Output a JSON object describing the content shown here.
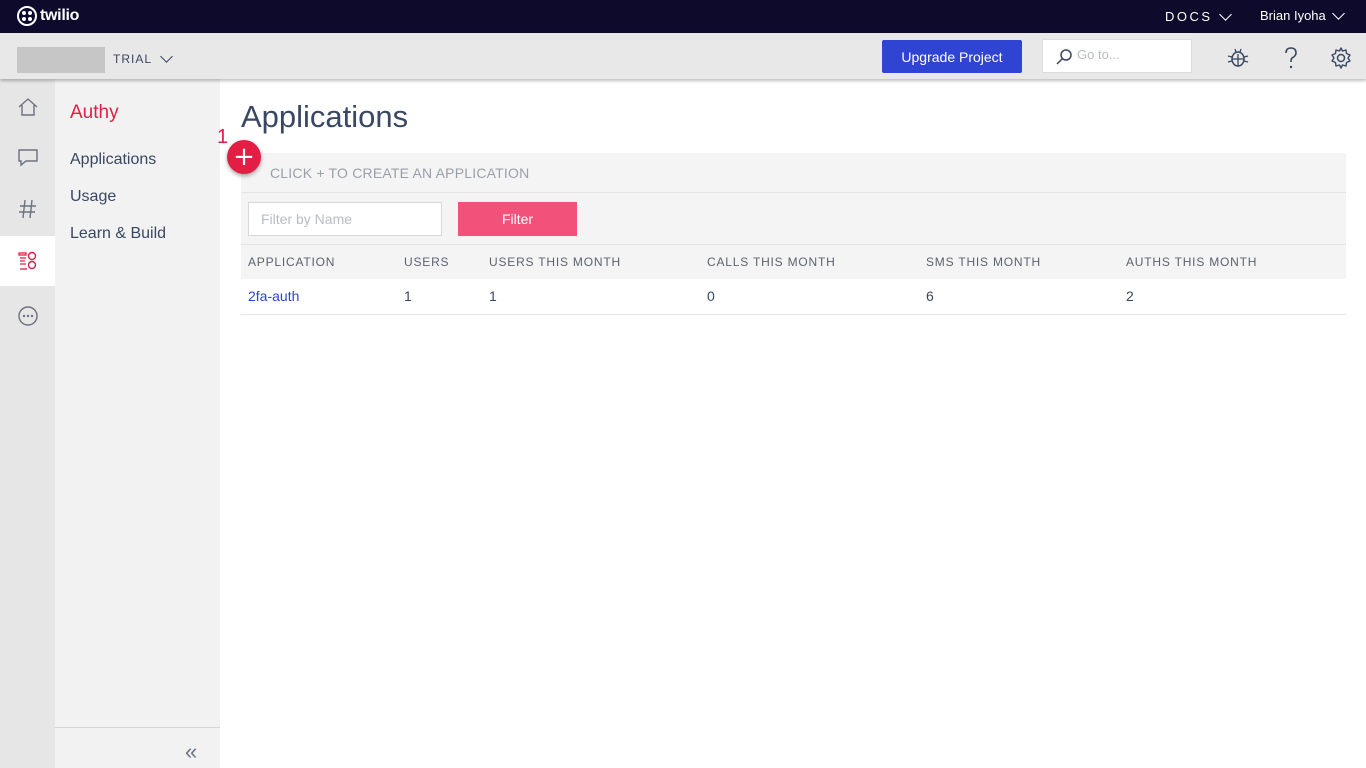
{
  "topbar": {
    "logo_text": "twilio",
    "docs_label": "DOCS",
    "user_name": "Brian Iyoha"
  },
  "subbar": {
    "project_plan": "TRIAL",
    "upgrade_label": "Upgrade Project",
    "search_placeholder": "Go to..."
  },
  "sidenav": {
    "title": "Authy",
    "items": [
      {
        "label": "Applications"
      },
      {
        "label": "Usage"
      },
      {
        "label": "Learn & Build"
      }
    ],
    "collapse_glyph": "«"
  },
  "main": {
    "page_title": "Applications",
    "annotation_number": "1",
    "create_hint": "CLICK + TO CREATE AN APPLICATION",
    "plus_glyph": "+",
    "filter_placeholder": "Filter by Name",
    "filter_label": "Filter",
    "columns": [
      "APPLICATION",
      "USERS",
      "USERS THIS MONTH",
      "CALLS THIS MONTH",
      "SMS THIS MONTH",
      "AUTHS THIS MONTH"
    ],
    "rows": [
      [
        "2fa-auth",
        "1",
        "1",
        "0",
        "6",
        "2"
      ]
    ]
  },
  "colors": {
    "topbar_bg": "#0d0a2c",
    "accent_red": "#e31e44",
    "upgrade_blue": "#2f44d3",
    "filter_pink": "#f2527a"
  },
  "icons": [
    "home-icon",
    "chat-icon",
    "hash-icon",
    "authy-icon",
    "more-icon",
    "search-icon",
    "debugger-bug-icon",
    "help-icon",
    "settings-gear-icon"
  ]
}
